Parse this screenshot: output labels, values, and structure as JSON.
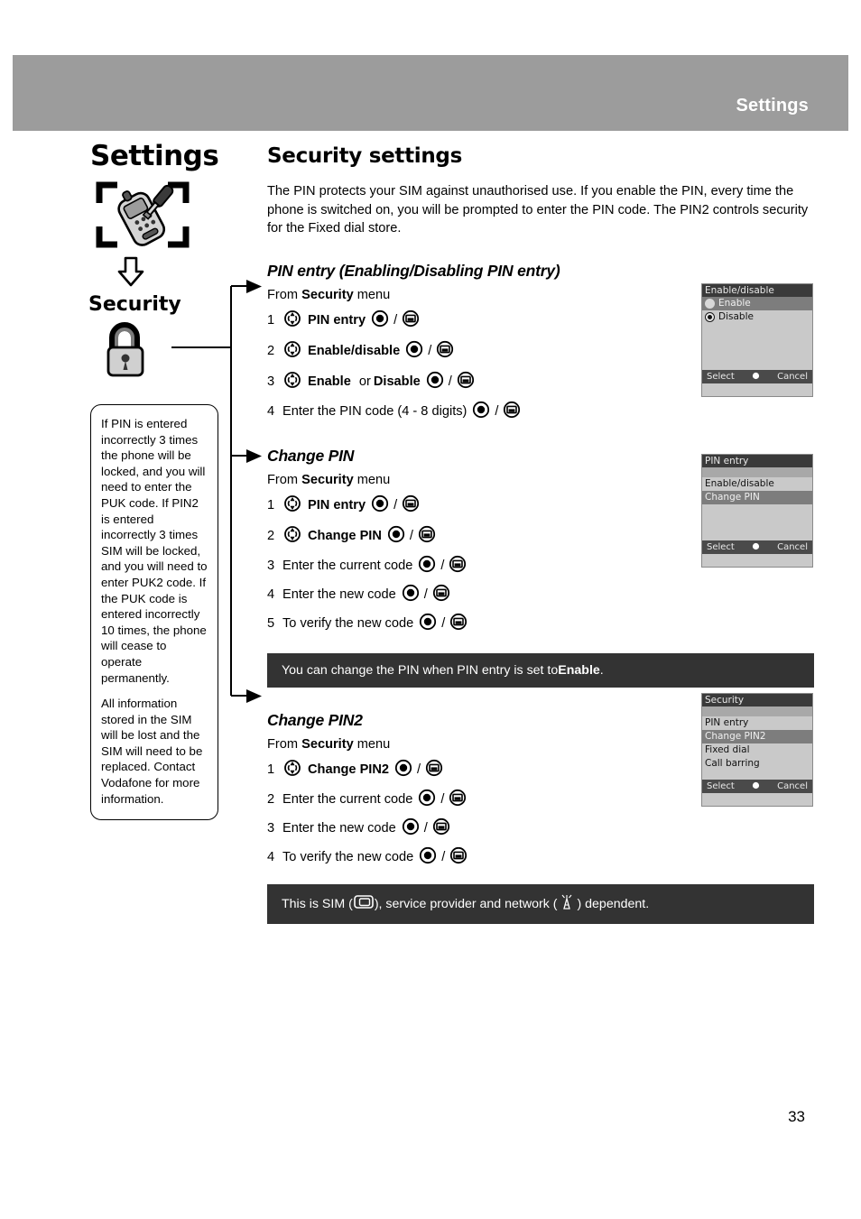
{
  "header": {
    "title": "Settings"
  },
  "left_column": {
    "chapter_title": "Settings",
    "chapter_icon": "phone-with-screwdriver-icon",
    "flow_arrow_icon": "down-arrow-icon",
    "subchapter_title": "Security",
    "subchapter_icon": "padlock-icon"
  },
  "note_box": {
    "paragraphs": [
      "If PIN is entered incorrectly 3 times the phone will be locked, and you will need to enter the PUK code. If PIN2 is entered incorrectly 3 times SIM will be locked, and you will need to enter PUK2 code. If the PUK code is entered incorrectly 10 times, the phone will cease to operate permanently.",
      "All information stored in the SIM will be lost and the SIM will need to be replaced. Contact Vodafone for more information."
    ]
  },
  "main": {
    "section_title": "Security settings",
    "intro": "The PIN protects your SIM against unauthorised use. If you enable the PIN, every time the phone is switched on, you will be prompted to enter the PIN code. The PIN2 controls security for the Fixed dial store.",
    "subsections": [
      {
        "heading": "PIN entry (Enabling/Disabling PIN entry)",
        "from_prefix": "From ",
        "from_bold": "Security",
        "from_suffix": " menu",
        "steps": [
          {
            "num": "1",
            "nav": true,
            "text": "PIN entry",
            "bold": true,
            "text2": "",
            "bold2": false
          },
          {
            "num": "2",
            "nav": true,
            "text": "Enable/disable",
            "bold": true,
            "text2": "",
            "bold2": false
          },
          {
            "num": "3",
            "nav": true,
            "text": "Enable",
            "bold": true,
            "text2": "or",
            "text3": "Disable",
            "bold2": false
          },
          {
            "num": "4",
            "nav": false,
            "text": "Enter the PIN code (4 - 8 digits)",
            "bold": false,
            "text2": "",
            "bold2": false
          }
        ]
      },
      {
        "heading": "Change PIN",
        "from_prefix": "From ",
        "from_bold": "Security",
        "from_suffix": " menu",
        "steps": [
          {
            "num": "1",
            "nav": true,
            "text": "PIN entry",
            "bold": true
          },
          {
            "num": "2",
            "nav": true,
            "text": "Change PIN",
            "bold": true
          },
          {
            "num": "3",
            "nav": false,
            "text": "Enter the current code",
            "bold": false
          },
          {
            "num": "4",
            "nav": false,
            "text": "Enter the new code",
            "bold": false
          },
          {
            "num": "5",
            "nav": false,
            "text": "To verify the new code",
            "bold": false
          }
        ]
      },
      {
        "heading": "Change PIN2",
        "from_prefix": "From ",
        "from_bold": "Security",
        "from_suffix": " menu",
        "steps": [
          {
            "num": "1",
            "nav": true,
            "text": "Change PIN2",
            "bold": true
          },
          {
            "num": "2",
            "nav": false,
            "text": "Enter the current code",
            "bold": false
          },
          {
            "num": "3",
            "nav": false,
            "text": "Enter the new code",
            "bold": false
          },
          {
            "num": "4",
            "nav": false,
            "text": "To verify the new code",
            "bold": false
          }
        ]
      }
    ],
    "notices": [
      {
        "prefix": "You can change the PIN when PIN entry is set to ",
        "bold": "Enable",
        "suffix": "."
      },
      {
        "prefix": "This is SIM (",
        "mid": "), service provider and network (",
        "suffix": ") dependent."
      }
    ]
  },
  "screens": [
    {
      "title": "Enable/disable",
      "has_gap": false,
      "rows": [
        {
          "label": "Enable",
          "highlight": true,
          "radio": "empty"
        },
        {
          "label": "Disable",
          "highlight": false,
          "radio": "filled"
        }
      ],
      "softkey_left": "Select",
      "softkey_center": "center-key-icon",
      "softkey_right": "Cancel"
    },
    {
      "title": "PIN entry",
      "has_gap": true,
      "rows": [
        {
          "label": "Enable/disable",
          "highlight": false
        },
        {
          "label": "Change PIN",
          "highlight": true
        }
      ],
      "softkey_left": "Select",
      "softkey_center": "center-key-icon",
      "softkey_right": "Cancel"
    },
    {
      "title": "Security",
      "has_gap": true,
      "rows": [
        {
          "label": "PIN entry",
          "highlight": false
        },
        {
          "label": "Change PIN2",
          "highlight": true
        },
        {
          "label": "Fixed dial",
          "highlight": false
        },
        {
          "label": "Call barring",
          "highlight": false
        }
      ],
      "softkey_left": "Select",
      "softkey_center": "center-key-icon",
      "softkey_right": "Cancel"
    }
  ],
  "page_number": "33",
  "colors": {
    "header_band": "#9c9c9c",
    "notice_bar": "#333333",
    "screen_bg": "#c9c9c9",
    "screen_title_bar": "#3a3a3a",
    "screen_highlight": "#7d7d7d"
  }
}
